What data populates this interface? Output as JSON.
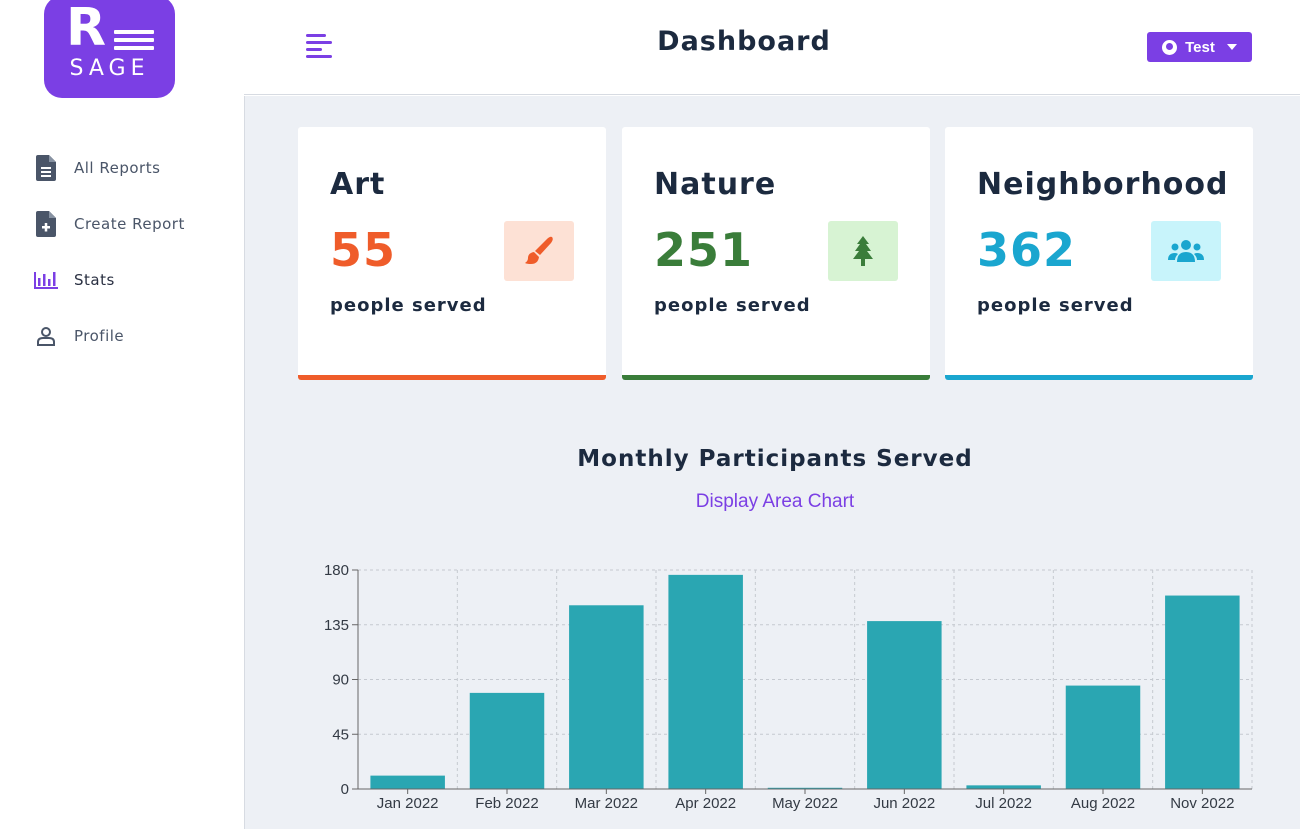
{
  "sidebar": {
    "logo": {
      "letter": "R",
      "text": "SAGE"
    },
    "items": [
      {
        "label": "All Reports",
        "icon": "file-icon"
      },
      {
        "label": "Create Report",
        "icon": "file-plus-icon"
      },
      {
        "label": "Stats",
        "icon": "bar-chart-icon"
      },
      {
        "label": "Profile",
        "icon": "user-icon"
      }
    ],
    "active_item": "Stats"
  },
  "header": {
    "title": "Dashboard",
    "user_button": "Test",
    "accent": "#7b3fe4"
  },
  "cards": [
    {
      "title": "Art",
      "count": "55",
      "caption": "people served",
      "color": "#ef5c2a",
      "icon": "paintbrush-icon"
    },
    {
      "title": "Nature",
      "count": "251",
      "caption": "people served",
      "color": "#3a7d3a",
      "icon": "tree-icon"
    },
    {
      "title": "Neighborhood",
      "count": "362",
      "caption": "people served",
      "color": "#1aa6cf",
      "icon": "users-icon"
    }
  ],
  "chart_section": {
    "title": "Monthly Participants Served",
    "toggle_label": "Display Area Chart"
  },
  "chart_data": {
    "type": "bar",
    "categories": [
      "Jan 2022",
      "Feb 2022",
      "Mar 2022",
      "Apr 2022",
      "May 2022",
      "Jun 2022",
      "Jul 2022",
      "Aug 2022",
      "Nov 2022"
    ],
    "values": [
      11,
      79,
      151,
      176,
      1,
      138,
      3,
      85,
      159
    ],
    "ylim": [
      0,
      180
    ],
    "yticks": [
      0,
      45,
      90,
      135,
      180
    ],
    "grid": true,
    "bar_color": "#2aa6b2"
  }
}
